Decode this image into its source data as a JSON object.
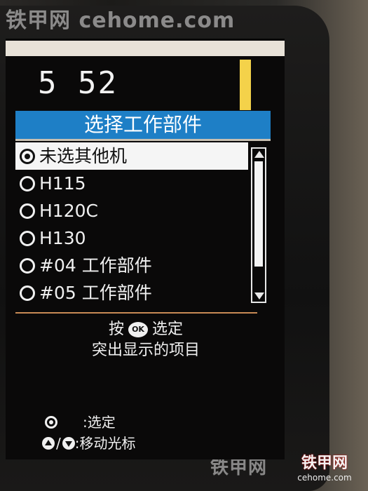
{
  "watermark": {
    "top": "铁甲网 cehome.com",
    "bottom_left": "铁甲网",
    "logo_big": "铁甲网",
    "logo_small": "cehome.com"
  },
  "status": {
    "counter": "5 52",
    "indicator_color": "#f4d24a"
  },
  "menu": {
    "title": "选择工作部件",
    "title_color": "#1e7fc6",
    "items": [
      {
        "label": "未选其他机",
        "selected": true
      },
      {
        "label": "H115",
        "selected": false
      },
      {
        "label": "H120C",
        "selected": false
      },
      {
        "label": "H130",
        "selected": false
      },
      {
        "label": "#04 工作部件",
        "selected": false
      },
      {
        "label": "#05 工作部件",
        "selected": false
      }
    ]
  },
  "instruction": {
    "line1_prefix": "按",
    "ok_badge": "OK",
    "line1_suffix": "选定",
    "line2": "突出显示的项目"
  },
  "legend": {
    "select_label": ":选定",
    "move_label": ":移动光标"
  }
}
